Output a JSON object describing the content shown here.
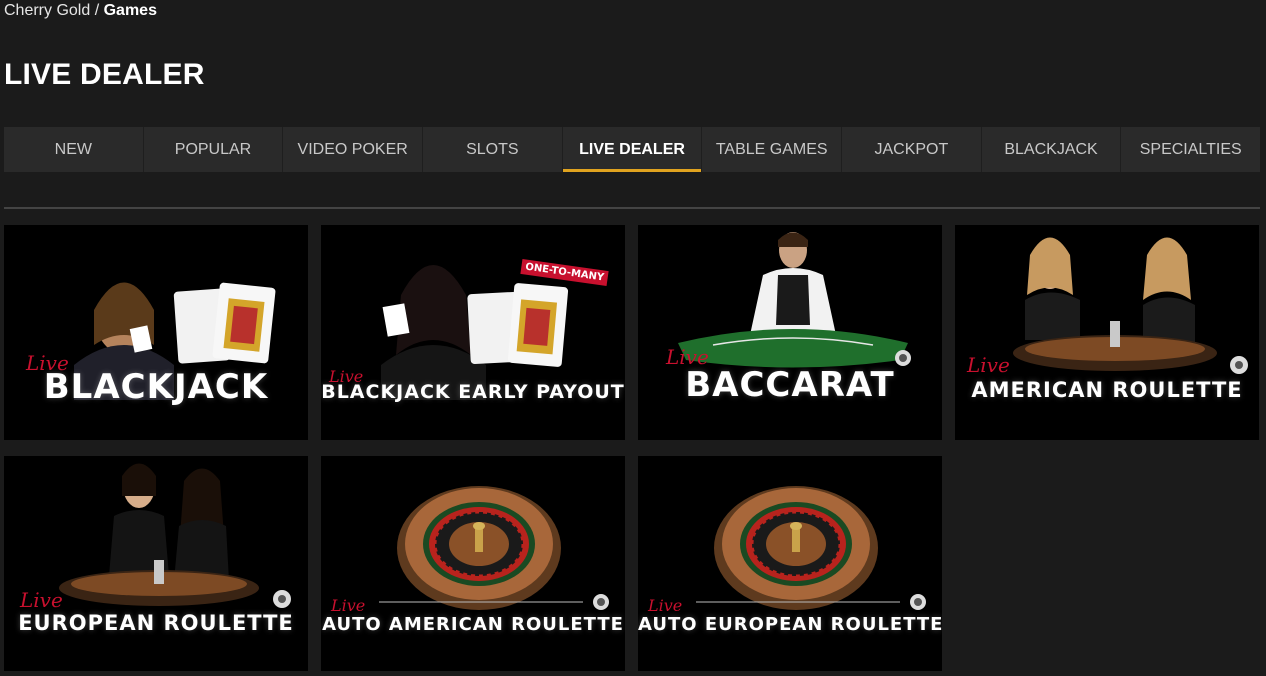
{
  "breadcrumb": {
    "root": "Cherry Gold",
    "separator": " / ",
    "current": "Games"
  },
  "page": {
    "title": "LIVE DEALER"
  },
  "tabs": [
    {
      "label": "NEW",
      "active": false
    },
    {
      "label": "POPULAR",
      "active": false
    },
    {
      "label": "VIDEO POKER",
      "active": false
    },
    {
      "label": "SLOTS",
      "active": false
    },
    {
      "label": "LIVE DEALER",
      "active": true
    },
    {
      "label": "TABLE GAMES",
      "active": false
    },
    {
      "label": "JACKPOT",
      "active": false
    },
    {
      "label": "BLACKJACK",
      "active": false
    },
    {
      "label": "SPECIALTIES",
      "active": false
    }
  ],
  "colors": {
    "accent": "#e0a31f",
    "live": "#c8102e",
    "background": "#1b1b1b",
    "tab_bg": "#2a2a2a"
  },
  "games": [
    {
      "live": "Live",
      "title": "BLACKJACK"
    },
    {
      "live": "Live",
      "title": "BLACKJACK EARLY PAYOUT",
      "badge": "ONE-TO-MANY"
    },
    {
      "live": "Live",
      "title": "BACCARAT"
    },
    {
      "live": "Live",
      "title": "AMERICAN ROULETTE"
    },
    {
      "live": "Live",
      "title": "EUROPEAN ROULETTE"
    },
    {
      "live": "Live",
      "title": "AUTO AMERICAN ROULETTE"
    },
    {
      "live": "Live",
      "title": "AUTO EUROPEAN ROULETTE"
    }
  ],
  "icons": {
    "chip": "roulette-chip-icon",
    "card": "playing-card-icon"
  }
}
